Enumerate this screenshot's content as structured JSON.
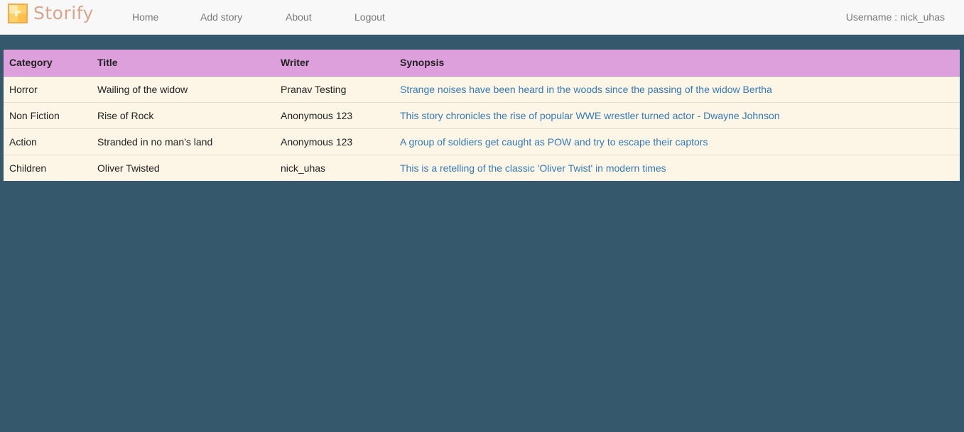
{
  "brand": {
    "name": "Storify",
    "logo_icon": "storify-logo-icon"
  },
  "nav": {
    "items": [
      {
        "label": "Home"
      },
      {
        "label": "Add story"
      },
      {
        "label": "About"
      },
      {
        "label": "Logout"
      }
    ],
    "user_label": "Username : nick_uhas"
  },
  "colors": {
    "page_background": "#35586c",
    "navbar_background": "#f8f8f8",
    "table_header": "#dda0dd",
    "table_row": "#fdf5e6",
    "link": "#337ab7",
    "brand_text": "#d8a58a"
  },
  "table": {
    "headers": {
      "category": "Category",
      "title": "Title",
      "writer": "Writer",
      "synopsis": "Synopsis"
    },
    "rows": [
      {
        "category": "Horror",
        "title": "Wailing of the widow",
        "writer": "Pranav Testing",
        "synopsis": "Strange noises have been heard in the woods since the passing of the widow Bertha"
      },
      {
        "category": "Non Fiction",
        "title": "Rise of Rock",
        "writer": "Anonymous 123",
        "synopsis": "This story chronicles the rise of popular WWE wrestler turned actor - Dwayne Johnson"
      },
      {
        "category": "Action",
        "title": "Stranded in no man's land",
        "writer": "Anonymous 123",
        "synopsis": "A group of soldiers get caught as POW and try to escape their captors"
      },
      {
        "category": "Children",
        "title": "Oliver Twisted",
        "writer": "nick_uhas",
        "synopsis": "This is a retelling of the classic 'Oliver Twist' in modern times"
      }
    ]
  }
}
